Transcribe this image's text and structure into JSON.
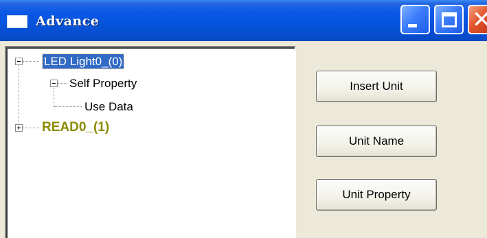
{
  "window": {
    "title": "Advance",
    "title_icon": "window-icon",
    "controls": [
      "minimize-icon",
      "maximize-icon",
      "close-icon"
    ],
    "close_glyph": "✕"
  },
  "tree": {
    "nodes": [
      {
        "label": "LED Light0_(0)",
        "expanded": true,
        "selected": true
      },
      {
        "label": "Self Property",
        "expanded": true,
        "selected": false
      },
      {
        "label": "Use Data",
        "selected": false
      },
      {
        "label": "READ0_(1)",
        "expanded": false,
        "selected": false,
        "color": "#8B8B00"
      }
    ]
  },
  "buttons": {
    "insert_unit": "Insert Unit",
    "unit_name": "Unit Name",
    "unit_property": "Unit Property"
  },
  "colors": {
    "titlebar": "#0653DB",
    "selection": "#316AC5",
    "read_node": "#8B8B00",
    "dialog_bg": "#ECE9D8"
  }
}
